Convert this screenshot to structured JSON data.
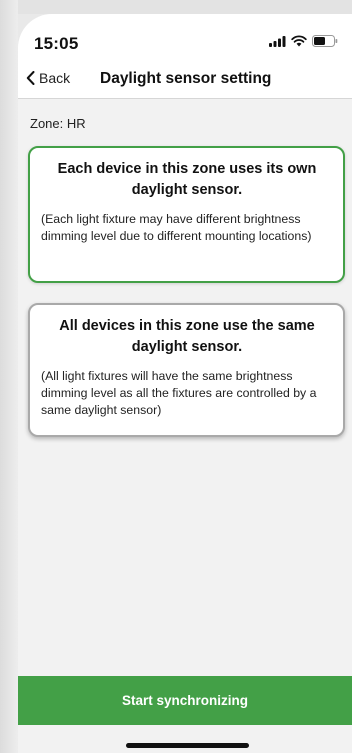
{
  "status_bar": {
    "time": "15:05",
    "icons": [
      "signal-icon",
      "wifi-icon",
      "battery-icon"
    ]
  },
  "nav": {
    "back_label": "Back",
    "title": "Daylight sensor setting"
  },
  "zone_label": "Zone: HR",
  "options": [
    {
      "title": "Each device in this zone uses its own daylight sensor.",
      "description": "(Each light fixture may have different brightness dimming level due to different mounting locations)",
      "selected": true
    },
    {
      "title": "All devices in this zone use the same daylight sensor.",
      "description": "(All light fixtures will have the same brightness dimming level as all the fixtures are controlled by a same daylight sensor)",
      "selected": false
    }
  ],
  "primary_button": "Start synchronizing",
  "colors": {
    "accent": "#43a047",
    "unselected_border": "#a9a9a9",
    "background": "#f2f2f2"
  }
}
